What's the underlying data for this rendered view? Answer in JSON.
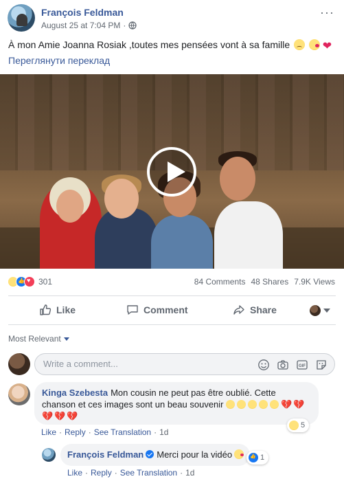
{
  "post": {
    "author": "François Feldman",
    "date": "August 25 at 7:04 PM",
    "separator": "·",
    "more_glyph": "···",
    "text": "À mon Amie Joanna Rosiak ,toutes mes pensées vont à sa famille",
    "text_emojis": [
      "sad-face",
      "kiss-face",
      "red-heart"
    ],
    "heart_glyph": "❤",
    "translate_link": "Переглянути переклад"
  },
  "video": {
    "play_icon": "play-button-icon"
  },
  "stats": {
    "reaction_types": [
      "sad",
      "like",
      "love"
    ],
    "reaction_count": "301",
    "comments": "84 Comments",
    "shares": "48 Shares",
    "views": "7.9K Views"
  },
  "actions": {
    "like": "Like",
    "comment": "Comment",
    "share": "Share"
  },
  "comments_section": {
    "sort_label": "Most Relevant",
    "composer_placeholder": "Write a comment..."
  },
  "comments": [
    {
      "author": "Kinga Szebesta",
      "text": "Mon cousin ne peut pas être oublié. Cette chanson et ces images sont un beau souvenir",
      "reaction_count": "5",
      "like": "Like",
      "reply": "Reply",
      "see_translation": "See Translation",
      "time": "1d"
    },
    {
      "author": "François Feldman",
      "verified": true,
      "text": "Merci pour la vidéo",
      "reaction_count": "1",
      "like": "Like",
      "reply": "Reply",
      "see_translation": "See Translation",
      "time": "1d"
    }
  ],
  "colors": {
    "link_blue": "#385898",
    "secondary_text": "#606770",
    "bubble_bg": "#f2f3f5",
    "like_blue": "#1877f2",
    "love_red": "#f33e58"
  }
}
